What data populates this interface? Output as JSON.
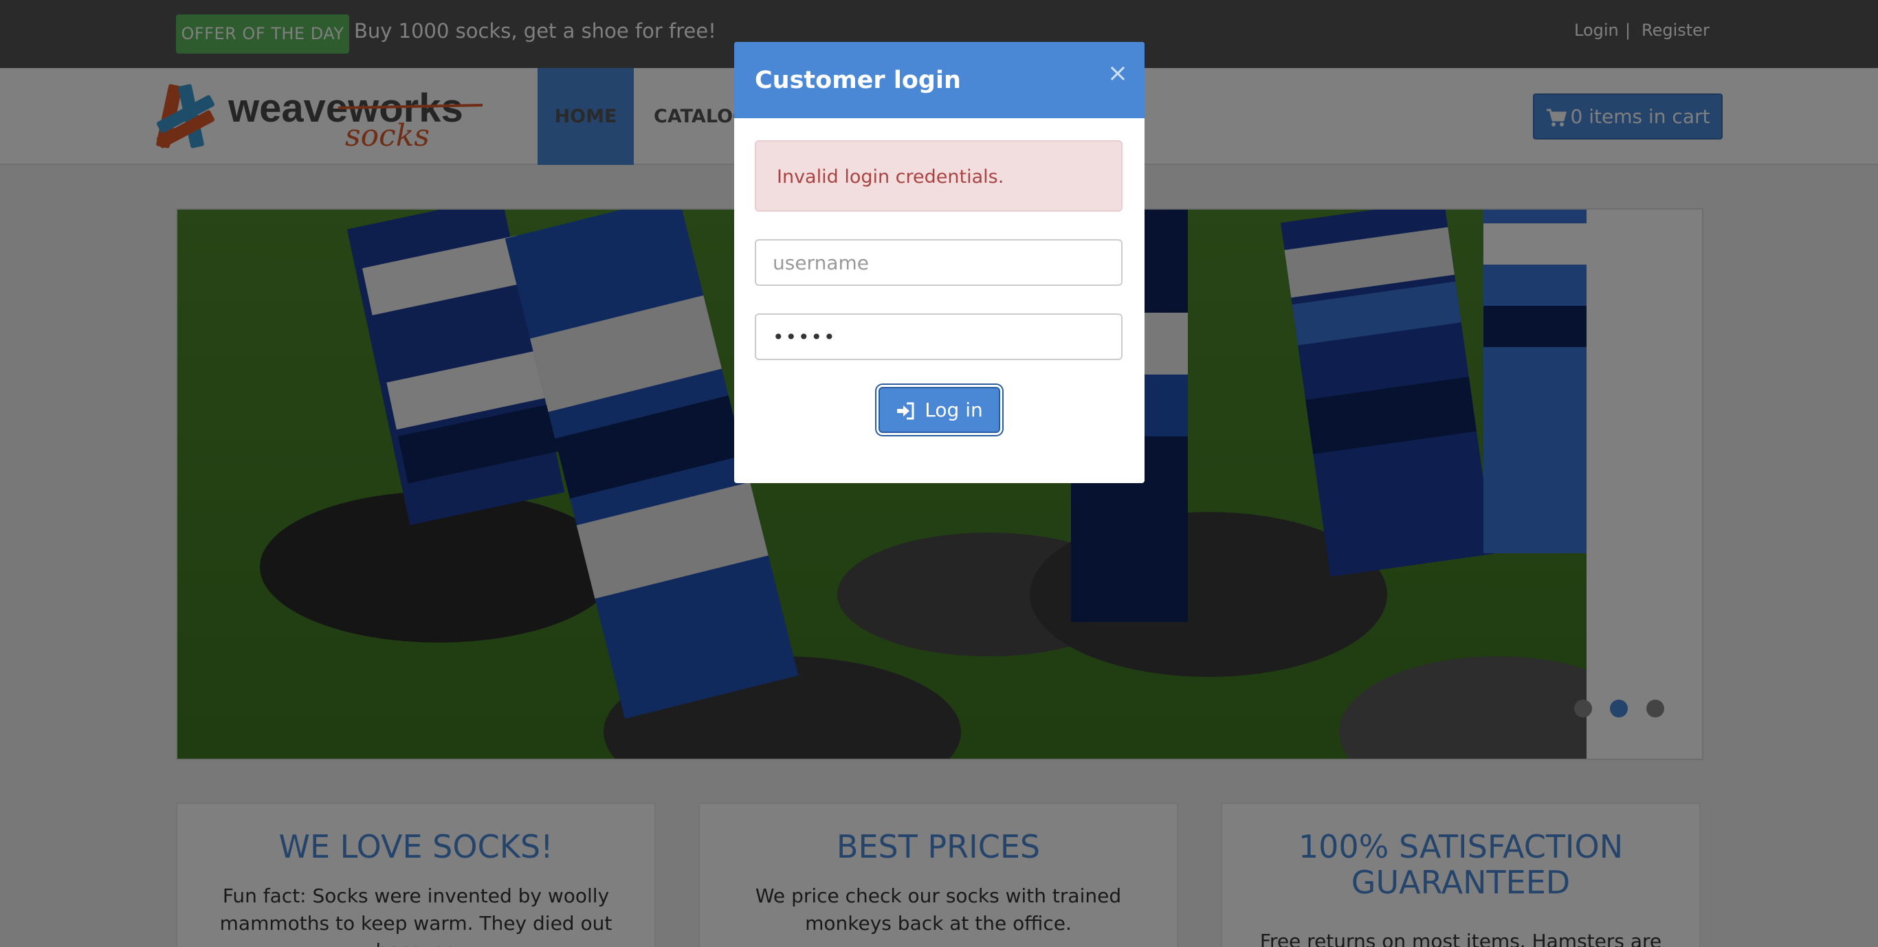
{
  "topbar": {
    "offer_badge": "OFFER OF THE DAY",
    "offer_text": "Buy 1000 socks, get a shoe for free!",
    "login": "Login",
    "separator": "|",
    "register": "Register"
  },
  "navbar": {
    "logo_primary": "weaveworks",
    "logo_secondary": "socks",
    "home": "HOME",
    "catalogue": "CATALOG",
    "cart": "0 items in cart",
    "cart_icon": "shopping-cart-icon"
  },
  "carousel": {
    "slide_count": 3,
    "active_index": 1
  },
  "features": [
    {
      "title": "WE LOVE SOCKS!",
      "text": "Fun fact: Socks were invented by woolly mammoths to keep warm. They died out because"
    },
    {
      "title": "BEST PRICES",
      "text": "We price check our socks with trained monkeys back at the office."
    },
    {
      "title": "100% SATISFACTION GUARANTEED",
      "text": "Free returns on most items. Hamsters are non-"
    }
  ],
  "modal": {
    "title": "Customer login",
    "close": "×",
    "alert": "Invalid login credentials.",
    "username_placeholder": "username",
    "password_value": "•••••",
    "login_button": "Log in",
    "login_icon": "sign-in-icon"
  },
  "colors": {
    "accent": "#4a88d6",
    "offer_green": "#5cb85c",
    "topbar": "#555555",
    "alert_bg": "#f2dede",
    "alert_text": "#a94442"
  }
}
